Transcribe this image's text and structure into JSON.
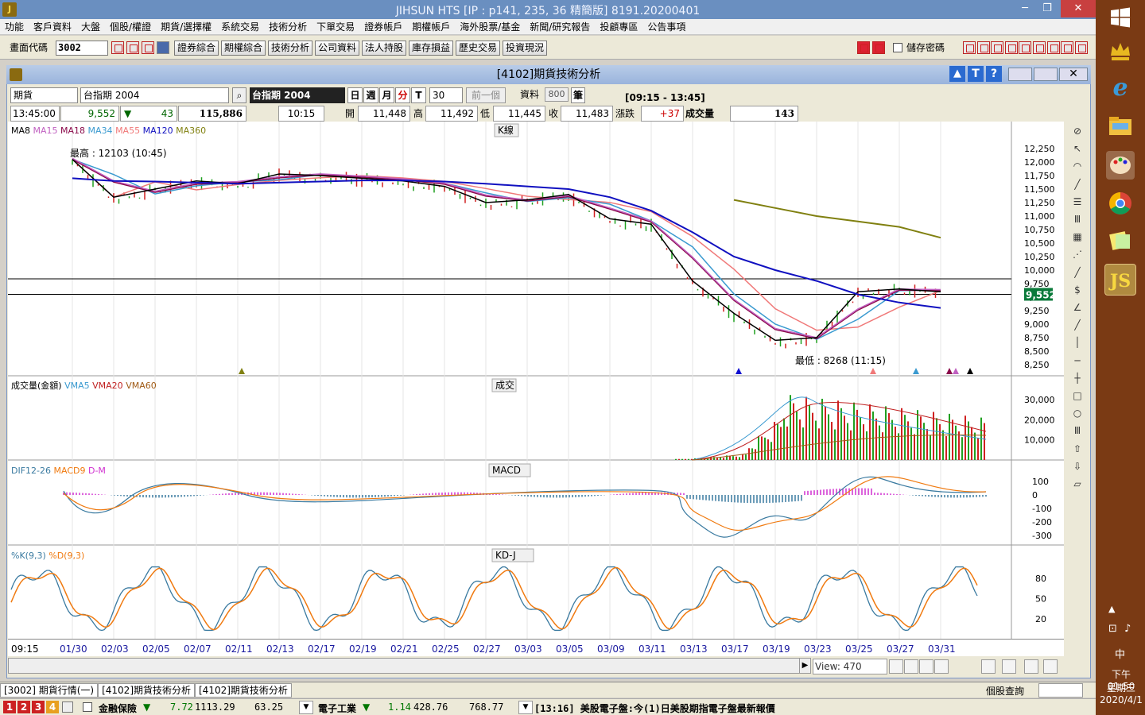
{
  "window": {
    "title": "JIHSUN HTS     [IP : p141, 235, 36 精簡版] 8191.20200401",
    "min": "─",
    "restore": "❐",
    "close": "✕",
    "icon": "jihsun-logo-icon"
  },
  "menu": [
    "功能",
    "客戶資料",
    "大盤",
    "個股/權證",
    "期貨/選擇權",
    "系統交易",
    "技術分析",
    "下單交易",
    "證券帳戶",
    "期權帳戶",
    "海外股票/基金",
    "新聞/研究報告",
    "投顧專區",
    "公告事項"
  ],
  "toolbar": {
    "code_label": "畫面代碼",
    "code_value": "3002",
    "buttons": [
      "證券綜合",
      "期權綜合",
      "技術分析",
      "公司資料",
      "法人持股",
      "庫存損益",
      "歷史交易",
      "投資現況"
    ],
    "save_pwd": "儲存密碼"
  },
  "child": {
    "title": "[4102]期貨技術分析"
  },
  "controls": {
    "market": "期貨",
    "contract": "台指期 2004",
    "contract_display": "台指期 2004",
    "periods": [
      "日",
      "週",
      "月",
      "分",
      "T"
    ],
    "minutes": "30",
    "prev": "前一個",
    "data_label": "資料",
    "data_count": "800",
    "unit": "筆",
    "session": "[09:15 - 13:45]"
  },
  "quote": {
    "time": "13:45:00",
    "price": "9,552",
    "change": "43",
    "volume_total": "115,886",
    "bar_time": "10:15",
    "open_label": "開",
    "open": "11,448",
    "high_label": "高",
    "high": "11,492",
    "low_label": "低",
    "low": "11,445",
    "close_label": "收",
    "close": "11,483",
    "chg_label": "漲跌",
    "chg": "+37",
    "vol_label": "成交量",
    "vol": "143"
  },
  "panels": {
    "k": {
      "title": "K線",
      "legend": [
        {
          "t": "MA8",
          "c": "#000000"
        },
        {
          "t": "MA15",
          "c": "#c060c0"
        },
        {
          "t": "MA18",
          "c": "#8a0a4a"
        },
        {
          "t": "MA34",
          "c": "#3a9ad0"
        },
        {
          "t": "MA55",
          "c": "#f07878"
        },
        {
          "t": "MA120",
          "c": "#1010c0"
        },
        {
          "t": "MA360",
          "c": "#808010"
        }
      ],
      "high_note": "最高 : 12103 (10:45)",
      "low_note": "最低 : 8268 (11:15)",
      "last_price": "9,552",
      "ticks": [
        "12,250",
        "12,000",
        "11,750",
        "11,500",
        "11,250",
        "11,000",
        "10,750",
        "10,500",
        "10,250",
        "10,000",
        "9,750",
        "9,500",
        "9,250",
        "9,000",
        "8,750",
        "8,500",
        "8,250"
      ]
    },
    "vol": {
      "title": "成交",
      "legend": [
        {
          "t": "成交量(金額)",
          "c": "#000000"
        },
        {
          "t": "VMA5",
          "c": "#3a9ad0"
        },
        {
          "t": "VMA20",
          "c": "#c02020"
        },
        {
          "t": "VMA60",
          "c": "#a05a14"
        }
      ],
      "ticks": [
        "30,000",
        "20,000",
        "10,000"
      ]
    },
    "macd": {
      "title": "MACD",
      "legend": [
        {
          "t": "DIF12-26",
          "c": "#3a7aa0"
        },
        {
          "t": "MACD9",
          "c": "#f07a10"
        },
        {
          "t": "D-M",
          "c": "#d030d0"
        }
      ],
      "ticks": [
        "100",
        "0",
        "-100",
        "-200",
        "-300"
      ]
    },
    "kd": {
      "title": "KD-J",
      "legend": [
        {
          "t": "%K(9,3)",
          "c": "#3a7aa0"
        },
        {
          "t": "%D(9,3)",
          "c": "#f07a10"
        }
      ],
      "ticks": [
        "80",
        "50",
        "20"
      ]
    }
  },
  "xaxis": [
    "09:15",
    "01/30",
    "02/03",
    "02/05",
    "02/07",
    "02/11",
    "02/13",
    "02/17",
    "02/19",
    "02/21",
    "02/25",
    "02/27",
    "03/03",
    "03/05",
    "03/09",
    "03/11",
    "03/13",
    "03/17",
    "03/19",
    "03/23",
    "03/25",
    "03/27",
    "03/31"
  ],
  "view": "View: 470",
  "tabs": [
    "[3002] 期貨行情(一)",
    "[4102]期貨技術分析",
    "[4102]期貨技術分析"
  ],
  "stock_query": "個股查詢",
  "status": {
    "nums": [
      "1",
      "2",
      "3",
      "4"
    ],
    "sector1": "金融保險",
    "s1_chg": "7.72",
    "s1_idx": "1113.29",
    "s1_vol": "63.25",
    "sector2": "電子工業",
    "s2_chg": "1.14",
    "s2_idx": "428.76",
    "s2_vol": "768.77",
    "news": "[13:16] 美股電子盤:今(1)日美股期指電子盤最新報價"
  },
  "clock": {
    "time": "下午 01:50",
    "weekday": "星期三",
    "date": "2020/4/1",
    "ime": "中"
  },
  "chart_data": {
    "type": "line",
    "title": "K線",
    "x": [
      "01/30",
      "02/03",
      "02/05",
      "02/07",
      "02/11",
      "02/13",
      "02/17",
      "02/19",
      "02/21",
      "02/25",
      "02/27",
      "03/03",
      "03/05",
      "03/09",
      "03/11",
      "03/13",
      "03/17",
      "03/19",
      "03/23",
      "03/25",
      "03/27",
      "03/31"
    ],
    "series": [
      {
        "name": "MA8",
        "values": [
          12050,
          11350,
          11500,
          11650,
          11600,
          11780,
          11750,
          11700,
          11650,
          11550,
          11250,
          11300,
          11400,
          10950,
          10850,
          9800,
          9200,
          8700,
          8750,
          9600,
          9650,
          9600
        ]
      },
      {
        "name": "MA120",
        "values": [
          11700,
          11650,
          11640,
          11620,
          11600,
          11620,
          11640,
          11660,
          11660,
          11640,
          11600,
          11550,
          11500,
          11350,
          11100,
          10700,
          10250,
          10000,
          9800,
          9550,
          9400,
          9300
        ]
      },
      {
        "name": "MA360",
        "values": [
          null,
          null,
          null,
          null,
          null,
          null,
          null,
          null,
          null,
          null,
          null,
          null,
          null,
          null,
          null,
          null,
          11300,
          11150,
          11000,
          10900,
          10800,
          10600
        ]
      }
    ],
    "ylim": [
      8250,
      12250
    ]
  }
}
